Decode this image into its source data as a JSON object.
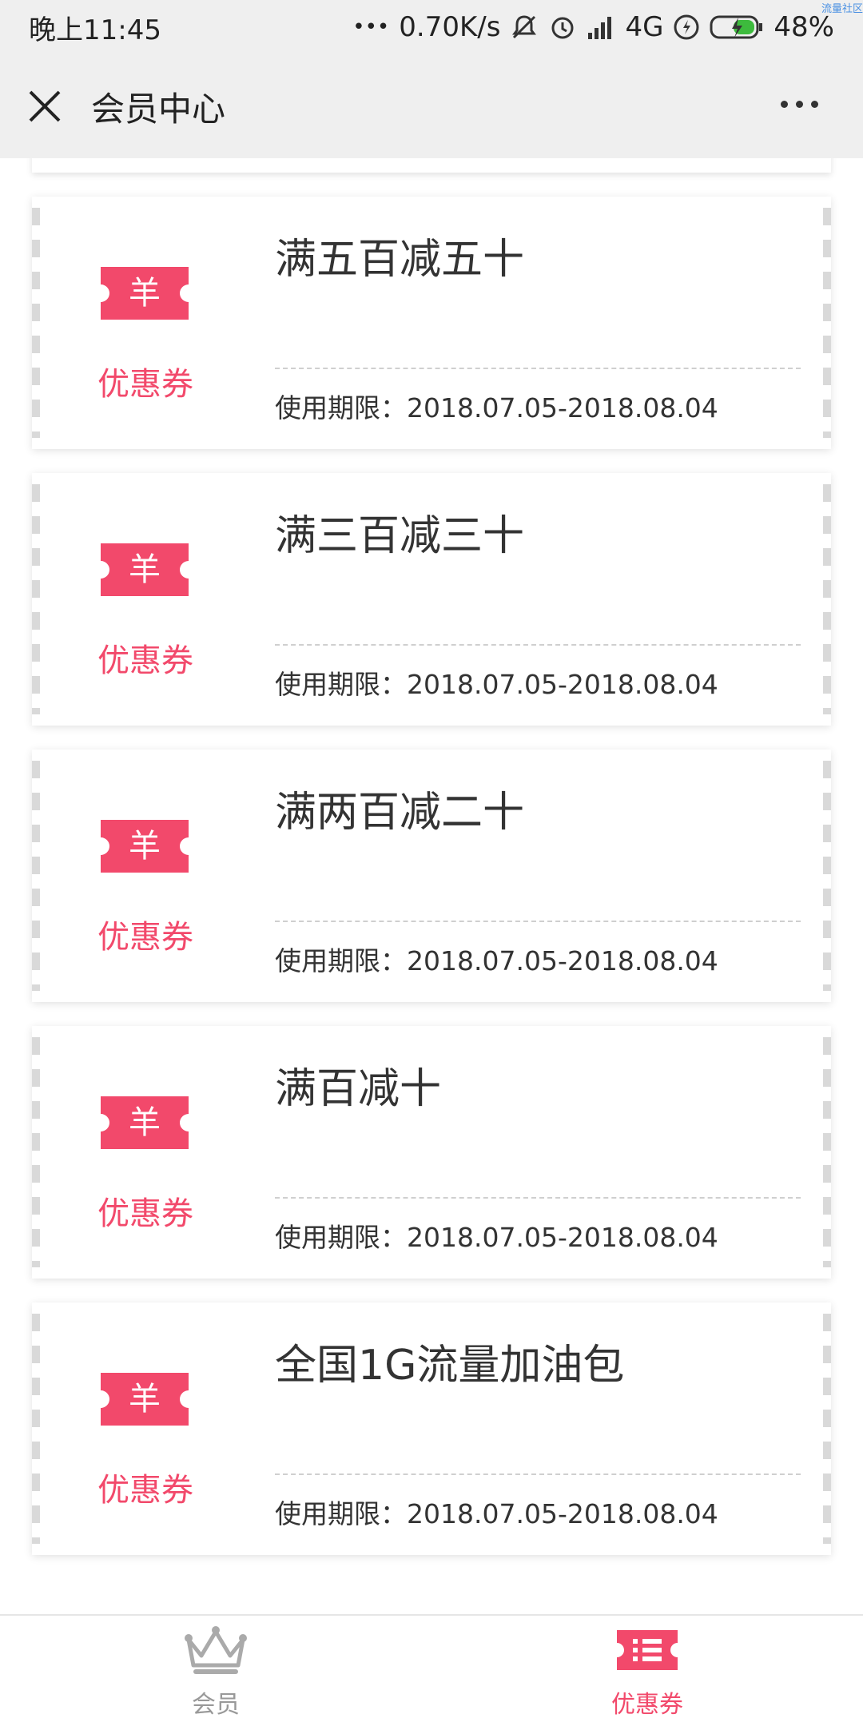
{
  "status_bar": {
    "time": "晚上11:45",
    "dots": "•••",
    "net_speed": "0.70K/s",
    "network": "4G",
    "battery": "48%",
    "watermark": "流量社区"
  },
  "header": {
    "title": "会员中心",
    "close_icon": "close-icon",
    "more_icon": "more-icon"
  },
  "coupons": [
    {
      "label": "优惠券",
      "title": "满五百减五十",
      "validity": "使用期限：2018.07.05-2018.08.04",
      "icon_glyph": "羊"
    },
    {
      "label": "优惠券",
      "title": "满三百减三十",
      "validity": "使用期限：2018.07.05-2018.08.04",
      "icon_glyph": "羊"
    },
    {
      "label": "优惠券",
      "title": "满两百减二十",
      "validity": "使用期限：2018.07.05-2018.08.04",
      "icon_glyph": "羊"
    },
    {
      "label": "优惠券",
      "title": "满百减十",
      "validity": "使用期限：2018.07.05-2018.08.04",
      "icon_glyph": "羊"
    },
    {
      "label": "优惠券",
      "title": "全国1G流量加油包",
      "validity": "使用期限：2018.07.05-2018.08.04",
      "icon_glyph": "羊"
    }
  ],
  "tabs": [
    {
      "label": "会员",
      "icon": "crown-icon",
      "active": false
    },
    {
      "label": "优惠券",
      "icon": "coupon-icon",
      "active": true
    }
  ],
  "colors": {
    "accent": "#f2496b",
    "header_bg": "#efefef",
    "inactive": "#999999"
  }
}
